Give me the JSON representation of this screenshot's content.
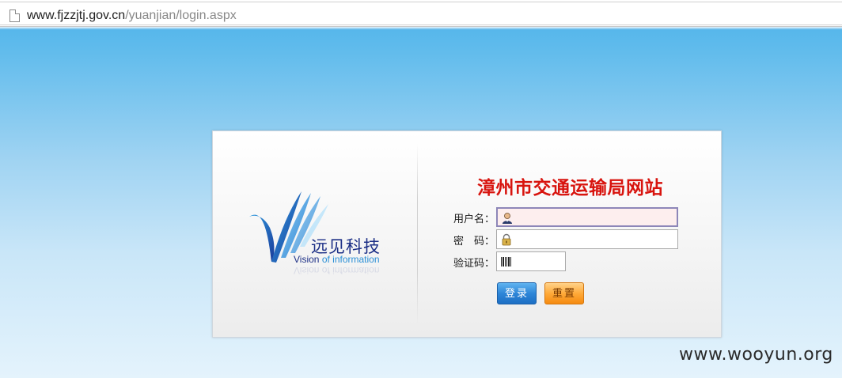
{
  "browser": {
    "url_host": "www.fjzzjtj.gov.cn",
    "url_path": "/yuanjian/login.aspx"
  },
  "logo": {
    "name_cn": "远见科技",
    "tagline_part1": "Vision ",
    "tagline_part2": "of information",
    "tagline_full": "Vision of information"
  },
  "login": {
    "title": "漳州市交通运输局网站",
    "username_label": "用户名：",
    "password_label": "密　码：",
    "captcha_label": "验证码：",
    "username_value": "",
    "password_value": "",
    "captcha_value": "",
    "login_button": "登录",
    "reset_button": "重置"
  },
  "watermark": "www.wooyun.org",
  "colors": {
    "title_red": "#d8140e",
    "background_blue": "#49b0e9",
    "login_button_blue": "#2e86d8",
    "reset_button_orange": "#ffaa3a",
    "logo_navy": "#1c2f86"
  },
  "icons": {
    "page": "page-icon",
    "user": "user-icon",
    "lock": "lock-icon",
    "barcode": "barcode-icon"
  }
}
